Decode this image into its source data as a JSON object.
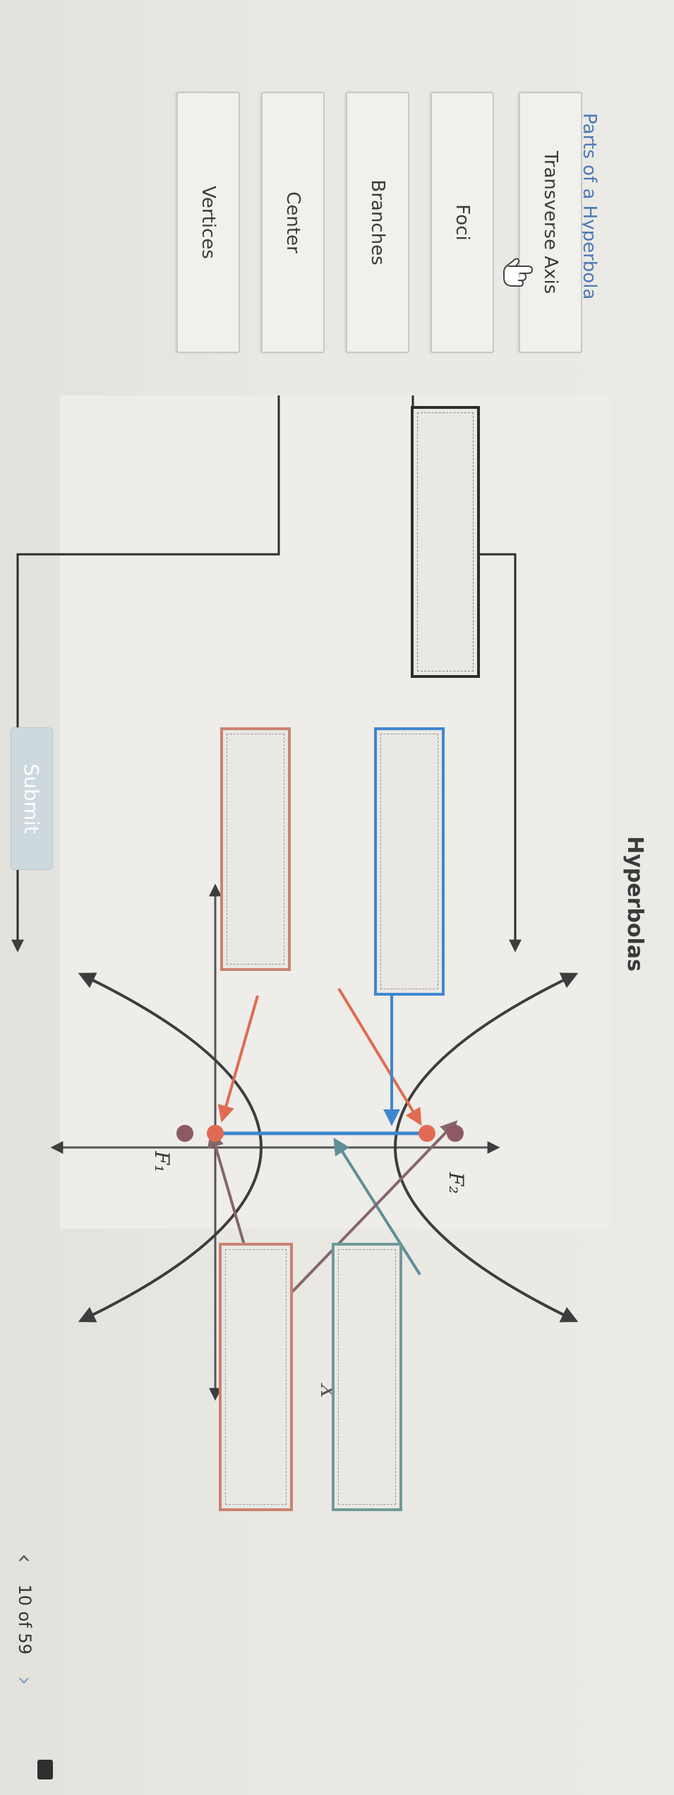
{
  "page": {
    "title": "Hyperbolas",
    "bank_title": "Parts of a Hyperbola"
  },
  "choices": [
    {
      "label": "Transverse Axis"
    },
    {
      "label": "Foci"
    },
    {
      "label": "Branches"
    },
    {
      "label": "Center"
    },
    {
      "label": "Vertices"
    }
  ],
  "diagram": {
    "focus_1_label": "F₁",
    "focus_2_label": "F₂",
    "x_axis_label": "X",
    "colors": {
      "curve": "#3d3d3d",
      "focus": "#e06b52",
      "vertex": "#8c5a60",
      "transverse": "#3f86d0",
      "teal_arrow": "#5f8e98",
      "brown_arrow": "#85666b",
      "box_black": "#2c2c2c",
      "box_red": "#c9836f",
      "box_blue": "#3f86d0",
      "box_teal": "#6f9a97"
    }
  },
  "submit_label": "Submit",
  "pager": {
    "text": "10 of 59",
    "prev_icon": "chevron-left-icon",
    "next_icon": "chevron-right-icon"
  }
}
